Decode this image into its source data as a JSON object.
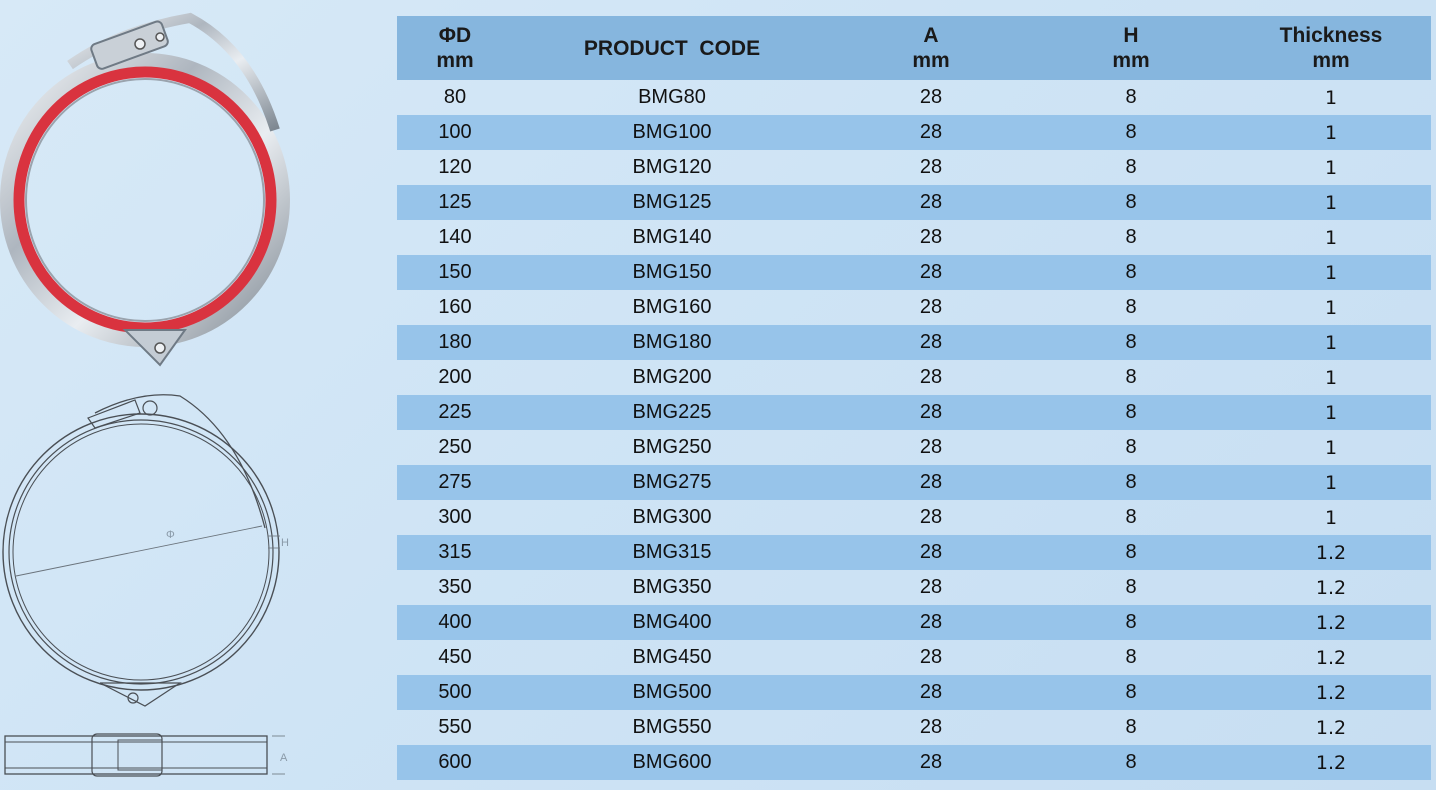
{
  "drawing": {
    "phi_label": "Φ",
    "h_label": "H",
    "a_label": "A"
  },
  "table": {
    "headers": [
      {
        "line1": "ΦD",
        "line2": "mm"
      },
      {
        "line1": "PRODUCT  CODE",
        "line2": ""
      },
      {
        "line1": "A",
        "line2": "mm"
      },
      {
        "line1": "H",
        "line2": "mm"
      },
      {
        "line1": "Thickness",
        "line2": "mm"
      }
    ],
    "rows": [
      [
        "80",
        "BMG80",
        "28",
        "8",
        "1"
      ],
      [
        "100",
        "BMG100",
        "28",
        "8",
        "1"
      ],
      [
        "120",
        "BMG120",
        "28",
        "8",
        "1"
      ],
      [
        "125",
        "BMG125",
        "28",
        "8",
        "1"
      ],
      [
        "140",
        "BMG140",
        "28",
        "8",
        "1"
      ],
      [
        "150",
        "BMG150",
        "28",
        "8",
        "1"
      ],
      [
        "160",
        "BMG160",
        "28",
        "8",
        "1"
      ],
      [
        "180",
        "BMG180",
        "28",
        "8",
        "1"
      ],
      [
        "200",
        "BMG200",
        "28",
        "8",
        "1"
      ],
      [
        "225",
        "BMG225",
        "28",
        "8",
        "1"
      ],
      [
        "250",
        "BMG250",
        "28",
        "8",
        "1"
      ],
      [
        "275",
        "BMG275",
        "28",
        "8",
        "1"
      ],
      [
        "300",
        "BMG300",
        "28",
        "8",
        "1"
      ],
      [
        "315",
        "BMG315",
        "28",
        "8",
        "1.2"
      ],
      [
        "350",
        "BMG350",
        "28",
        "8",
        "1.2"
      ],
      [
        "400",
        "BMG400",
        "28",
        "8",
        "1.2"
      ],
      [
        "450",
        "BMG450",
        "28",
        "8",
        "1.2"
      ],
      [
        "500",
        "BMG500",
        "28",
        "8",
        "1.2"
      ],
      [
        "550",
        "BMG550",
        "28",
        "8",
        "1.2"
      ],
      [
        "600",
        "BMG600",
        "28",
        "8",
        "1.2"
      ]
    ]
  }
}
